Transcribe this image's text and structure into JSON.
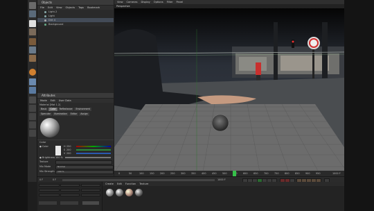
{
  "left_toolbar": {
    "items": [
      "move-tool",
      "scale-tool",
      "rotate-tool",
      "select-tool",
      "texture-tool",
      "axis-tool",
      "object-tool",
      "sphere-tool",
      "lights-tool",
      "camera-tool",
      "render-tool",
      "render-region-tool",
      "deform-tool",
      "spline-tool",
      "sculpt-tool"
    ]
  },
  "objects_panel": {
    "title": "Objects",
    "menu": [
      "File",
      "Edit",
      "View",
      "Objects",
      "Tags",
      "Bookmark"
    ],
    "rows": [
      {
        "name": "Light.2",
        "selected": false
      },
      {
        "name": "Light",
        "selected": false
      },
      {
        "name": "Dirt 4",
        "selected": true
      },
      {
        "name": "Background",
        "selected": false
      }
    ]
  },
  "attributes_panel": {
    "title": "Attributes",
    "menu": [
      "Mode",
      "Edit",
      "User Data"
    ],
    "material_name": "Material [Mat 1.2]",
    "tabs_row1": [
      "Basic",
      "Color",
      "Reflectance",
      "Environment"
    ],
    "tabs_row2": [
      "Specular",
      "Illumination",
      "Editor",
      "Assign"
    ],
    "active_tab": "Color",
    "section": "Color",
    "color_label": "● Color",
    "color_channels": [
      {
        "label": "H",
        "value": "250"
      },
      {
        "label": "S",
        "value": "200"
      },
      {
        "label": "V",
        "value": "200"
      }
    ],
    "brightness_label": "● Brightness",
    "brightness_value": "100 %",
    "texture_label": "Texture",
    "mix_mode_label": "Mix Mode",
    "mix_mode_value": "Normal",
    "mix_strength_label": "Mix Strength",
    "mix_strength_value": "100 %"
  },
  "viewport": {
    "menu": [
      "View",
      "Cameras",
      "Display",
      "Options",
      "Filter",
      "Panel"
    ],
    "label": "Perspective"
  },
  "timeline": {
    "ticks": [
      "0",
      "50",
      "100",
      "150",
      "200",
      "250",
      "300",
      "350",
      "400",
      "450",
      "500",
      "550",
      "600",
      "650",
      "700",
      "750",
      "800",
      "850",
      "900",
      "950"
    ],
    "end_frame": "1000 F",
    "current_frame": "0 F",
    "min_frame": "0 F",
    "max_frame": "1000 F",
    "playhead_fraction": 0.55
  },
  "material_manager": {
    "menu": [
      "Create",
      "Edit",
      "Function",
      "Texture"
    ],
    "materials": [
      "Mat",
      "Mat.1",
      "Mat.2",
      "Mat.3"
    ]
  },
  "coord_panel": {
    "rows": [
      [
        "0 cm",
        "0 cm",
        "0 °"
      ],
      [
        "0 cm",
        "0 cm",
        "0 °"
      ],
      [
        "0 cm",
        "0 cm",
        "0 °"
      ]
    ],
    "buttons": [
      "Object",
      "Size",
      "Apply"
    ]
  },
  "colors": {
    "accent_green": "#36c14a",
    "selected_row": "#434b57",
    "highlight_red": "#d03030"
  }
}
